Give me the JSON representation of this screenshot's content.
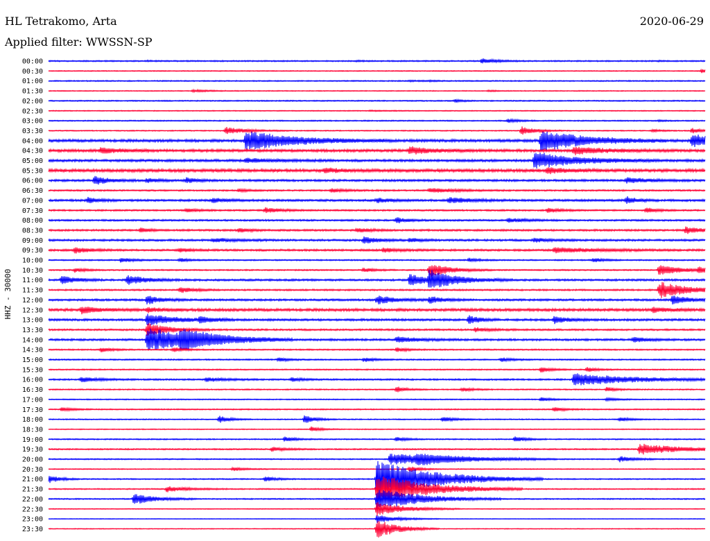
{
  "header": {
    "station": "HL Tetrakomo, Arta",
    "date": "2020-06-29",
    "filter": "Applied filter: WWSSN-SP"
  },
  "chart_data": {
    "type": "line",
    "title": "HL Tetrakomo, Arta",
    "subtitle": "Applied filter: WWSSN-SP",
    "ylabel": "HHZ - 30000",
    "xlabel": "",
    "date": "2020-06-29",
    "row_interval_minutes": 30,
    "trace_colors": [
      "#0000ff",
      "#ff0033"
    ],
    "categories": [
      "00:00",
      "00:30",
      "01:00",
      "01:30",
      "02:00",
      "02:30",
      "03:00",
      "03:30",
      "04:00",
      "04:30",
      "05:00",
      "05:30",
      "06:00",
      "06:30",
      "07:00",
      "07:30",
      "08:00",
      "08:30",
      "09:00",
      "09:30",
      "10:00",
      "10:30",
      "11:00",
      "11:30",
      "12:00",
      "12:30",
      "13:00",
      "13:30",
      "14:00",
      "14:30",
      "15:00",
      "15:30",
      "16:00",
      "16:30",
      "17:00",
      "17:30",
      "18:00",
      "18:30",
      "19:00",
      "19:30",
      "20:00",
      "20:30",
      "21:00",
      "21:30",
      "22:00",
      "22:30",
      "23:00",
      "23:30"
    ],
    "series": [
      {
        "noise": 1.0,
        "bursts": [
          [
            0.15,
            0.5,
            12
          ],
          [
            0.47,
            0.6,
            8
          ],
          [
            0.66,
            3.5,
            20
          ],
          [
            0.93,
            0.4,
            10
          ]
        ]
      },
      {
        "noise": 0.7,
        "bursts": [
          [
            0.995,
            2.5,
            12
          ]
        ]
      },
      {
        "noise": 0.9,
        "bursts": [
          [
            0.55,
            0.8,
            15
          ],
          [
            0.58,
            0.6,
            15
          ]
        ]
      },
      {
        "noise": 0.7,
        "bursts": [
          [
            0.22,
            1.5,
            25
          ],
          [
            0.67,
            1.0,
            15
          ]
        ]
      },
      {
        "noise": 0.9,
        "bursts": [
          [
            0.62,
            2.0,
            10
          ]
        ]
      },
      {
        "noise": 0.7,
        "bursts": [
          [
            0.49,
            0.6,
            30
          ]
        ]
      },
      {
        "noise": 0.9,
        "bursts": [
          [
            0.7,
            2.5,
            15
          ],
          [
            0.93,
            1.0,
            10
          ]
        ]
      },
      {
        "noise": 0.8,
        "bursts": [
          [
            0.27,
            5.0,
            30
          ],
          [
            0.72,
            6.0,
            20
          ],
          [
            0.92,
            2.0,
            12
          ],
          [
            0.98,
            4.0,
            12
          ]
        ]
      },
      {
        "noise": 2.0,
        "bursts": [
          [
            0.3,
            14.0,
            70
          ],
          [
            0.75,
            16.0,
            60
          ],
          [
            0.98,
            10.0,
            30
          ]
        ]
      },
      {
        "noise": 2.0,
        "bursts": [
          [
            0.08,
            4.0,
            25
          ],
          [
            0.55,
            5.0,
            35
          ],
          [
            0.8,
            5.0,
            45
          ]
        ]
      },
      {
        "noise": 1.8,
        "bursts": [
          [
            0.3,
            3.0,
            40
          ],
          [
            0.74,
            12.0,
            60
          ]
        ]
      },
      {
        "noise": 2.2,
        "bursts": [
          [
            0.42,
            3.0,
            25
          ],
          [
            0.76,
            4.0,
            30
          ]
        ]
      },
      {
        "noise": 1.6,
        "bursts": [
          [
            0.07,
            6.0,
            20
          ],
          [
            0.15,
            3.0,
            15
          ],
          [
            0.21,
            3.5,
            15
          ],
          [
            0.88,
            4.0,
            30
          ]
        ]
      },
      {
        "noise": 1.2,
        "bursts": [
          [
            0.29,
            2.0,
            15
          ],
          [
            0.43,
            2.5,
            20
          ],
          [
            0.58,
            3.0,
            40
          ]
        ]
      },
      {
        "noise": 1.6,
        "bursts": [
          [
            0.06,
            4.0,
            15
          ],
          [
            0.25,
            3.0,
            20
          ],
          [
            0.5,
            3.0,
            20
          ],
          [
            0.61,
            4.0,
            30
          ],
          [
            0.88,
            5.0,
            15
          ]
        ]
      },
      {
        "noise": 1.2,
        "bursts": [
          [
            0.21,
            3.0,
            15
          ],
          [
            0.33,
            4.0,
            20
          ],
          [
            0.76,
            3.0,
            20
          ],
          [
            0.91,
            3.5,
            15
          ]
        ]
      },
      {
        "noise": 1.3,
        "bursts": [
          [
            0.53,
            4.0,
            15
          ],
          [
            0.7,
            3.0,
            25
          ]
        ]
      },
      {
        "noise": 1.4,
        "bursts": [
          [
            0.14,
            3.0,
            15
          ],
          [
            0.29,
            3.0,
            15
          ],
          [
            0.47,
            3.0,
            20
          ],
          [
            0.97,
            5.0,
            20
          ]
        ]
      },
      {
        "noise": 1.5,
        "bursts": [
          [
            0.25,
            2.5,
            30
          ],
          [
            0.48,
            5.0,
            20
          ],
          [
            0.55,
            3.0,
            15
          ],
          [
            0.74,
            3.0,
            20
          ]
        ]
      },
      {
        "noise": 1.5,
        "bursts": [
          [
            0.04,
            4.0,
            20
          ],
          [
            0.2,
            3.0,
            15
          ],
          [
            0.51,
            3.0,
            20
          ],
          [
            0.77,
            3.5,
            60
          ]
        ]
      },
      {
        "noise": 1.0,
        "bursts": [
          [
            0.11,
            3.0,
            20
          ],
          [
            0.2,
            2.5,
            15
          ],
          [
            0.64,
            2.5,
            15
          ],
          [
            0.83,
            3.0,
            15
          ]
        ]
      },
      {
        "noise": 1.0,
        "bursts": [
          [
            0.04,
            3.0,
            15
          ],
          [
            0.48,
            3.0,
            15
          ],
          [
            0.58,
            10.0,
            30
          ],
          [
            0.93,
            8.0,
            30
          ],
          [
            0.99,
            4.0,
            15
          ]
        ]
      },
      {
        "noise": 1.5,
        "bursts": [
          [
            0.02,
            6.0,
            20
          ],
          [
            0.12,
            7.0,
            25
          ],
          [
            0.55,
            8.0,
            30
          ],
          [
            0.58,
            12.0,
            40
          ]
        ]
      },
      {
        "noise": 1.2,
        "bursts": [
          [
            0.2,
            4.0,
            20
          ],
          [
            0.93,
            12.0,
            40
          ]
        ]
      },
      {
        "noise": 1.5,
        "bursts": [
          [
            0.15,
            6.0,
            20
          ],
          [
            0.5,
            6.0,
            25
          ],
          [
            0.58,
            5.0,
            20
          ],
          [
            0.95,
            6.0,
            25
          ]
        ]
      },
      {
        "noise": 2.0,
        "bursts": [
          [
            0.05,
            5.0,
            25
          ],
          [
            0.15,
            3.0,
            20
          ],
          [
            0.92,
            4.0,
            20
          ]
        ]
      },
      {
        "noise": 1.6,
        "bursts": [
          [
            0.15,
            8.0,
            40
          ],
          [
            0.23,
            4.0,
            20
          ],
          [
            0.64,
            6.0,
            15
          ],
          [
            0.77,
            5.0,
            20
          ]
        ]
      },
      {
        "noise": 1.3,
        "bursts": [
          [
            0.15,
            10.0,
            30
          ],
          [
            0.65,
            3.0,
            20
          ]
        ]
      },
      {
        "noise": 1.5,
        "bursts": [
          [
            0.15,
            18.0,
            70
          ],
          [
            0.2,
            10.0,
            50
          ],
          [
            0.53,
            4.0,
            30
          ],
          [
            0.89,
            3.5,
            20
          ]
        ]
      },
      {
        "noise": 1.0,
        "bursts": [
          [
            0.08,
            3.0,
            15
          ],
          [
            0.19,
            3.0,
            15
          ],
          [
            0.53,
            3.0,
            15
          ]
        ]
      },
      {
        "noise": 1.0,
        "bursts": [
          [
            0.35,
            3.0,
            15
          ],
          [
            0.48,
            3.0,
            15
          ],
          [
            0.69,
            3.0,
            15
          ]
        ]
      },
      {
        "noise": 0.9,
        "bursts": [
          [
            0.75,
            4.0,
            15
          ],
          [
            0.82,
            3.5,
            15
          ]
        ]
      },
      {
        "noise": 1.2,
        "bursts": [
          [
            0.05,
            3.5,
            25
          ],
          [
            0.24,
            3.0,
            25
          ],
          [
            0.37,
            3.0,
            15
          ],
          [
            0.8,
            9.0,
            80
          ]
        ]
      },
      {
        "noise": 0.9,
        "bursts": [
          [
            0.53,
            4.0,
            15
          ],
          [
            0.63,
            3.0,
            15
          ],
          [
            0.85,
            3.0,
            15
          ]
        ]
      },
      {
        "noise": 0.8,
        "bursts": [
          [
            0.75,
            3.0,
            15
          ],
          [
            0.85,
            2.5,
            15
          ]
        ]
      },
      {
        "noise": 0.9,
        "bursts": [
          [
            0.02,
            3.0,
            15
          ],
          [
            0.77,
            3.5,
            15
          ]
        ]
      },
      {
        "noise": 0.8,
        "bursts": [
          [
            0.26,
            5.0,
            15
          ],
          [
            0.39,
            6.0,
            15
          ],
          [
            0.6,
            4.0,
            15
          ],
          [
            0.87,
            3.0,
            15
          ]
        ]
      },
      {
        "noise": 0.7,
        "bursts": [
          [
            0.4,
            3.5,
            15
          ]
        ]
      },
      {
        "noise": 0.9,
        "bursts": [
          [
            0.36,
            3.5,
            15
          ],
          [
            0.53,
            3.0,
            15
          ],
          [
            0.71,
            4.0,
            15
          ]
        ]
      },
      {
        "noise": 1.0,
        "bursts": [
          [
            0.34,
            3.0,
            20
          ],
          [
            0.9,
            8.0,
            60
          ]
        ]
      },
      {
        "noise": 0.9,
        "bursts": [
          [
            0.52,
            8.0,
            80
          ],
          [
            0.56,
            5.0,
            60
          ],
          [
            0.87,
            4.0,
            20
          ]
        ]
      },
      {
        "noise": 0.7,
        "bursts": [
          [
            0.28,
            2.5,
            20
          ],
          [
            0.55,
            4.0,
            15
          ]
        ]
      },
      {
        "noise": 0.9,
        "bursts": [
          [
            0.0,
            6.0,
            15
          ],
          [
            0.33,
            3.5,
            15
          ],
          [
            0.5,
            28.0,
            80
          ]
        ]
      },
      {
        "noise": 0.9,
        "bursts": [
          [
            0.18,
            4.0,
            30
          ],
          [
            0.5,
            22.0,
            70
          ]
        ]
      },
      {
        "noise": 0.9,
        "bursts": [
          [
            0.13,
            8.0,
            30
          ],
          [
            0.5,
            16.0,
            60
          ]
        ]
      },
      {
        "noise": 0.6,
        "bursts": [
          [
            0.5,
            10.0,
            40
          ]
        ]
      },
      {
        "noise": 0.5,
        "bursts": [
          [
            0.5,
            6.0,
            30
          ]
        ]
      },
      {
        "noise": 0.6,
        "bursts": [
          [
            0.5,
            14.0,
            30
          ]
        ]
      }
    ]
  }
}
